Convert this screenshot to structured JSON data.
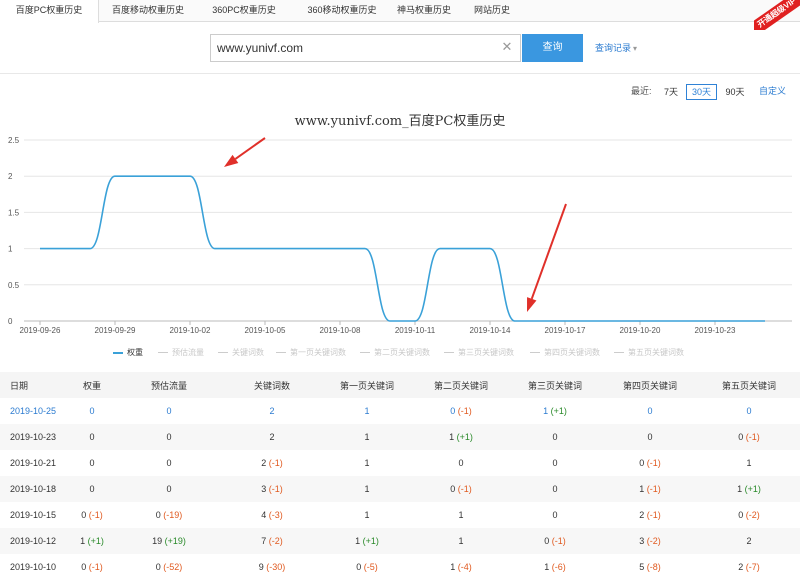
{
  "tabs": [
    {
      "label": "百度PC权重历史",
      "active": true
    },
    {
      "label": "百度移动权重历史",
      "active": false
    },
    {
      "label": "360PC权重历史",
      "active": false
    },
    {
      "label": "360移动权重历史",
      "active": false
    },
    {
      "label": "神马权重历史",
      "active": false
    },
    {
      "label": "网站历史",
      "active": false
    }
  ],
  "vip_badge": "开通超级VIP",
  "search": {
    "value": "www.yunivf.com",
    "button_label": "查询",
    "history_label": "查询记录"
  },
  "range": {
    "label": "最近:",
    "options": [
      "7天",
      "30天",
      "90天"
    ],
    "selected": "30天",
    "custom_label": "自定义"
  },
  "colors": {
    "accent": "#3a97e0",
    "line": "#3aa1d8",
    "arrow": "#e0302a",
    "down": "#e05a20",
    "up": "#2a8a2a"
  },
  "chart_data": {
    "type": "line",
    "title": "www.yunivf.com_百度PC权重历史",
    "x": [
      "2019-09-26",
      "2019-09-27",
      "2019-09-28",
      "2019-09-29",
      "2019-09-30",
      "2019-10-01",
      "2019-10-02",
      "2019-10-03",
      "2019-10-04",
      "2019-10-05",
      "2019-10-06",
      "2019-10-07",
      "2019-10-08",
      "2019-10-09",
      "2019-10-10",
      "2019-10-11",
      "2019-10-12",
      "2019-10-13",
      "2019-10-14",
      "2019-10-15",
      "2019-10-16",
      "2019-10-17",
      "2019-10-18",
      "2019-10-19",
      "2019-10-20",
      "2019-10-21",
      "2019-10-22",
      "2019-10-23",
      "2019-10-24",
      "2019-10-25"
    ],
    "x_tick_labels": [
      "2019-09-26",
      "2019-09-29",
      "2019-10-02",
      "2019-10-05",
      "2019-10-08",
      "2019-10-11",
      "2019-10-14",
      "2019-10-17",
      "2019-10-20",
      "2019-10-23"
    ],
    "series": [
      {
        "name": "权重",
        "values": [
          1,
          1,
          1,
          2,
          2,
          2,
          2,
          1,
          1,
          1,
          1,
          1,
          1,
          1,
          0,
          0,
          1,
          1,
          1,
          0,
          0,
          0,
          0,
          0,
          0,
          0,
          0,
          0,
          0,
          0
        ]
      }
    ],
    "ylim": [
      0,
      2.5
    ],
    "y_ticks": [
      "0",
      "0.5",
      "1",
      "1.5",
      "2",
      "2.5"
    ],
    "legend": [
      "权重",
      "预估流量",
      "关键词数",
      "第一页关键词数",
      "第二页关键词数",
      "第三页关键词数",
      "第四页关键词数",
      "第五页关键词数"
    ],
    "legend_active": [
      true,
      false,
      false,
      false,
      false,
      false,
      false,
      false
    ],
    "grid": true,
    "legend_position": "bottom"
  },
  "table": {
    "headers": [
      "日期",
      "权重",
      "预估流量",
      "关键词数",
      "第一页关键词",
      "第二页关键词",
      "第三页关键词",
      "第四页关键词",
      "第五页关键词"
    ],
    "rows": [
      [
        {
          "v": "2019-10-25"
        },
        {
          "v": "0"
        },
        {
          "v": "0"
        },
        {
          "v": "2"
        },
        {
          "v": "1"
        },
        {
          "v": "0",
          "d": "(-1)"
        },
        {
          "v": "1",
          "d": "(+1)"
        },
        {
          "v": "0"
        },
        {
          "v": "0"
        }
      ],
      [
        {
          "v": "2019-10-23"
        },
        {
          "v": "0"
        },
        {
          "v": "0"
        },
        {
          "v": "2"
        },
        {
          "v": "1"
        },
        {
          "v": "1",
          "d": "(+1)"
        },
        {
          "v": "0"
        },
        {
          "v": "0"
        },
        {
          "v": "0",
          "d": "(-1)"
        }
      ],
      [
        {
          "v": "2019-10-21"
        },
        {
          "v": "0"
        },
        {
          "v": "0"
        },
        {
          "v": "2",
          "d": "(-1)"
        },
        {
          "v": "1"
        },
        {
          "v": "0"
        },
        {
          "v": "0"
        },
        {
          "v": "0",
          "d": "(-1)"
        },
        {
          "v": "1"
        }
      ],
      [
        {
          "v": "2019-10-18"
        },
        {
          "v": "0"
        },
        {
          "v": "0"
        },
        {
          "v": "3",
          "d": "(-1)"
        },
        {
          "v": "1"
        },
        {
          "v": "0",
          "d": "(-1)"
        },
        {
          "v": "0"
        },
        {
          "v": "1",
          "d": "(-1)"
        },
        {
          "v": "1",
          "d": "(+1)"
        }
      ],
      [
        {
          "v": "2019-10-15"
        },
        {
          "v": "0",
          "d": "(-1)"
        },
        {
          "v": "0",
          "d": "(-19)"
        },
        {
          "v": "4",
          "d": "(-3)"
        },
        {
          "v": "1"
        },
        {
          "v": "1"
        },
        {
          "v": "0"
        },
        {
          "v": "2",
          "d": "(-1)"
        },
        {
          "v": "0",
          "d": "(-2)"
        }
      ],
      [
        {
          "v": "2019-10-12"
        },
        {
          "v": "1",
          "d": "(+1)"
        },
        {
          "v": "19",
          "d": "(+19)"
        },
        {
          "v": "7",
          "d": "(-2)"
        },
        {
          "v": "1",
          "d": "(+1)"
        },
        {
          "v": "1"
        },
        {
          "v": "0",
          "d": "(-1)"
        },
        {
          "v": "3",
          "d": "(-2)"
        },
        {
          "v": "2"
        }
      ],
      [
        {
          "v": "2019-10-10"
        },
        {
          "v": "0",
          "d": "(-1)"
        },
        {
          "v": "0",
          "d": "(-52)"
        },
        {
          "v": "9",
          "d": "(-30)"
        },
        {
          "v": "0",
          "d": "(-5)"
        },
        {
          "v": "1",
          "d": "(-4)"
        },
        {
          "v": "1",
          "d": "(-6)"
        },
        {
          "v": "5",
          "d": "(-8)"
        },
        {
          "v": "2",
          "d": "(-7)"
        }
      ]
    ]
  }
}
